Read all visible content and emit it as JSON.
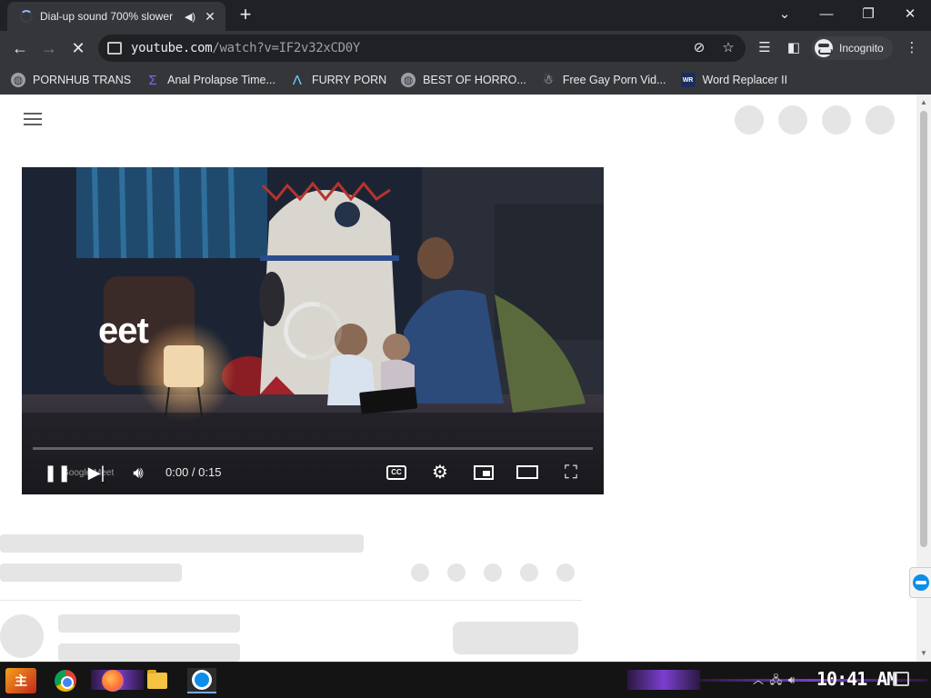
{
  "tab": {
    "title": "Dial-up sound 700% slower",
    "audio_icon": "speaker-icon",
    "close_icon": "close-icon"
  },
  "toolbar": {
    "url_host": "youtube.com",
    "url_path": "/watch?v=IF2v32xCD0Y",
    "incognito_label": "Incognito"
  },
  "bookmarks": [
    {
      "label": "PORNHUB TRANS",
      "icon": "globe-icon"
    },
    {
      "label": "Anal Prolapse Time...",
      "icon": "sigma-icon"
    },
    {
      "label": "FURRY PORN",
      "icon": "lambda-icon"
    },
    {
      "label": "BEST OF HORRO...",
      "icon": "globe-icon"
    },
    {
      "label": "Free Gay Porn Vid...",
      "icon": "robot-icon"
    },
    {
      "label": "Word Replacer II",
      "icon": "wr-icon"
    }
  ],
  "player": {
    "overlay_text": "eet",
    "time": "0:00 / 0:15",
    "watermark": "Google Meet",
    "progress": 0
  },
  "taskbar": {
    "start_label": "主",
    "clock": "10:41 AM"
  },
  "colors": {
    "chrome_dark": "#202124",
    "chrome_toolbar": "#35363a",
    "accent_blue": "#8ab4f8",
    "placeholder": "#e5e5e5",
    "progress_red": "#ff0000"
  }
}
